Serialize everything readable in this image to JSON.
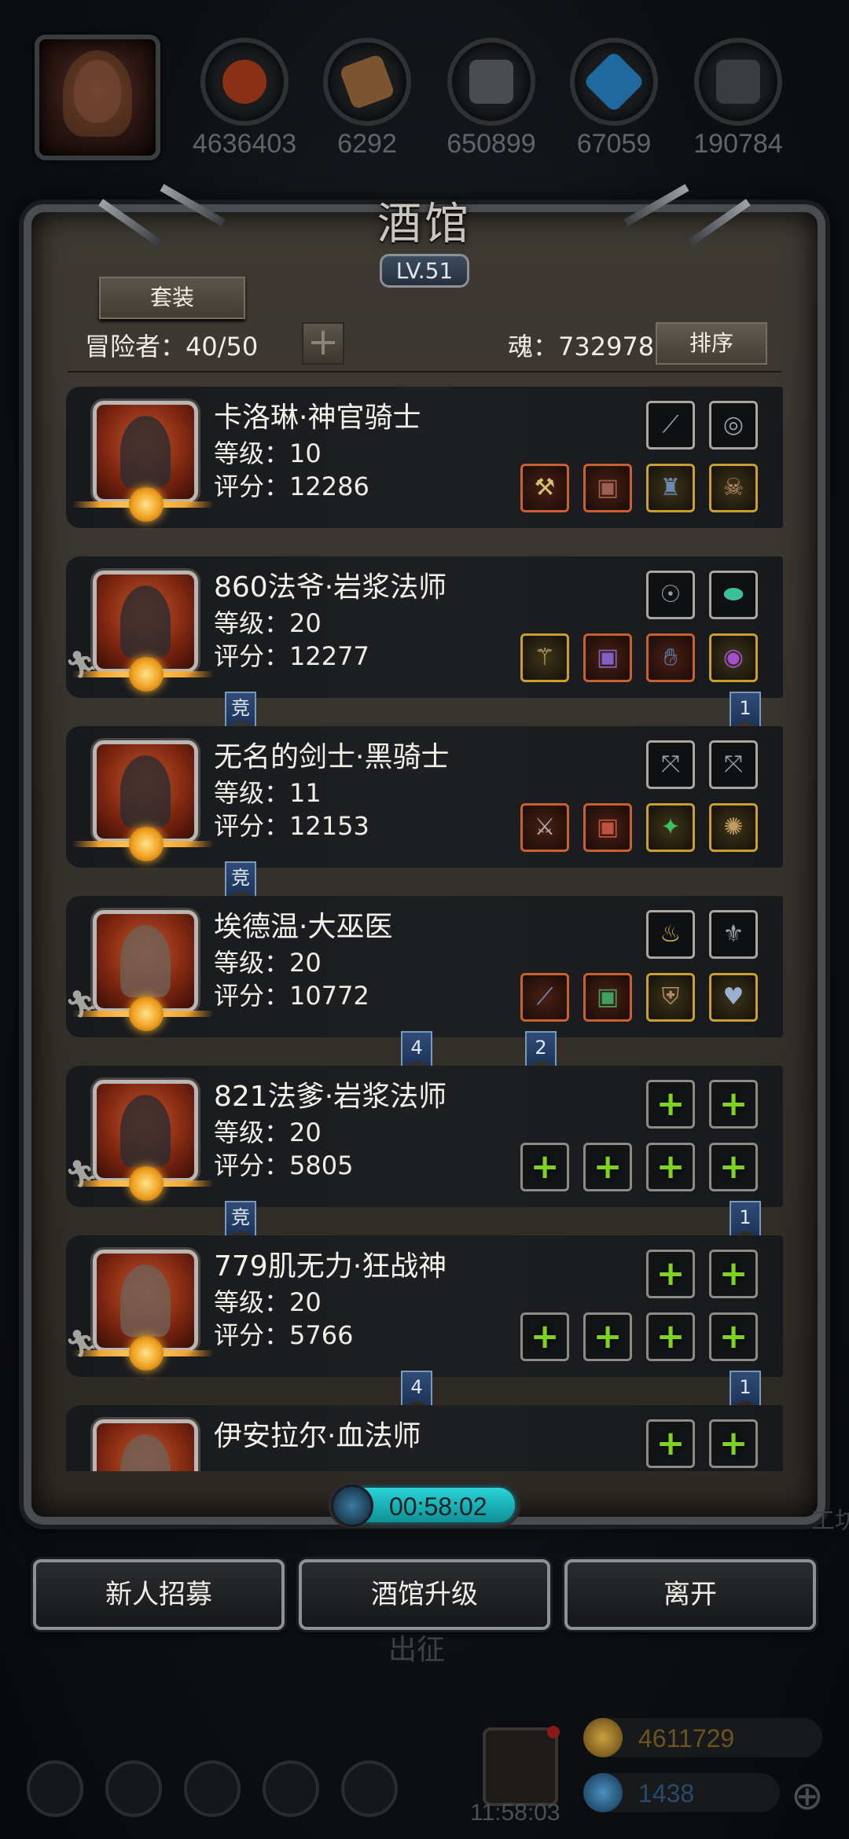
{
  "resources": [
    {
      "icon": "meat-icon",
      "value": "4636403",
      "color": "#7a2a10"
    },
    {
      "icon": "wood-icon",
      "value": "6292",
      "color": "#7a5530"
    },
    {
      "icon": "iron-ore-icon",
      "value": "650899",
      "color": "#4a4c4e"
    },
    {
      "icon": "crystal-icon",
      "value": "67059",
      "color": "#1e5a8a"
    },
    {
      "icon": "metal-ingot-icon",
      "value": "190784",
      "color": "#3a3c3e"
    }
  ],
  "tavern": {
    "title": "酒馆",
    "level": "LV.51",
    "suit_button": "套装",
    "adventurers_label": "冒险者：40/50",
    "add_button": "+",
    "soul_label": "魂：732978",
    "sort_button": "排序"
  },
  "heroes": [
    {
      "name": "卡洛琳·神官骑士",
      "level": "等级：10",
      "score": "评分：12286",
      "runner": false,
      "tags": []
    },
    {
      "name": "860法爷·岩浆法师",
      "level": "等级：20",
      "score": "评分：12277",
      "runner": true,
      "tags": [
        {
          "text": "竞"
        },
        {
          "text": "1"
        }
      ]
    },
    {
      "name": "无名的剑士·黑骑士",
      "level": "等级：11",
      "score": "评分：12153",
      "runner": false,
      "tags": [
        {
          "text": "竞"
        }
      ]
    },
    {
      "name": "埃德温·大巫医",
      "level": "等级：20",
      "score": "评分：10772",
      "runner": true,
      "tags": [
        {
          "text": "4"
        },
        {
          "text": "2"
        }
      ]
    },
    {
      "name": "821法爹·岩浆法师",
      "level": "等级：20",
      "score": "评分：5805",
      "runner": true,
      "tags": [
        {
          "text": "竞"
        },
        {
          "text": "1"
        }
      ]
    },
    {
      "name": "779肌无力·狂战神",
      "level": "等级：20",
      "score": "评分：5766",
      "runner": true,
      "tags": [
        {
          "text": "4"
        },
        {
          "text": "1"
        }
      ]
    },
    {
      "name": "伊安拉尔·血法师",
      "level": "",
      "score": "",
      "runner": false,
      "tags": []
    }
  ],
  "timer": "00:58:02",
  "buttons": {
    "recruit": "新人招募",
    "upgrade": "酒馆升级",
    "leave": "离开"
  },
  "background": {
    "expedition": "出征",
    "gold": "4611729",
    "gems": "1438",
    "clock": "11:58:03",
    "edge_text": "工坊"
  }
}
